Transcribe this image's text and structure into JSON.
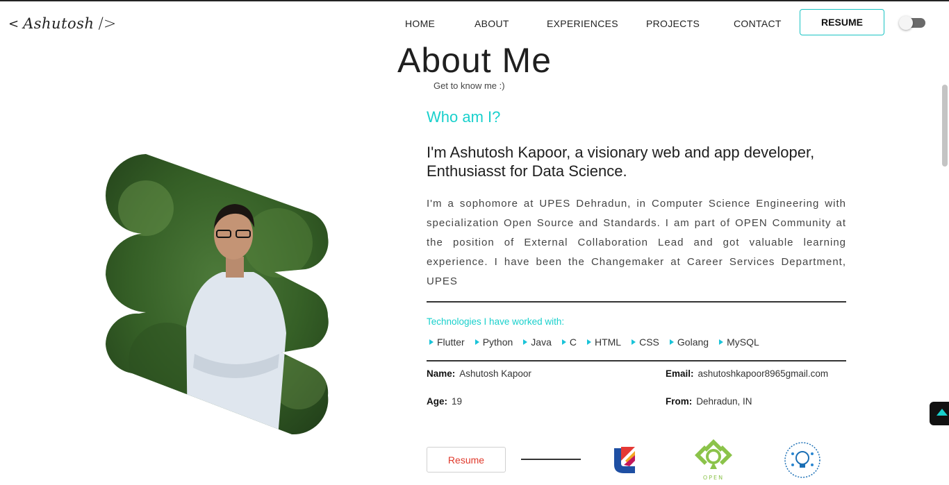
{
  "nav": {
    "logo_left": "<",
    "logo_name": "Ashutosh",
    "logo_right": "/>",
    "links": [
      {
        "label": "HOME"
      },
      {
        "label": "ABOUT"
      },
      {
        "label": "EXPERIENCES"
      },
      {
        "label": "PROJECTS"
      },
      {
        "label": "CONTACT"
      }
    ],
    "resume": "RESUME",
    "theme_toggle": "off"
  },
  "about": {
    "title": "About Me",
    "subtitle": "Get to know me :)",
    "who": "Who am I?",
    "headline": "I'm Ashutosh Kapoor, a visionary web and app developer, Enthusiasst for Data Science.",
    "bio": "I'm a sophomore at UPES Dehradun, in Computer Science Engineering with specialization Open Source and Standards. I am part of OPEN Community at the position of External Collaboration Lead and got valuable learning experience. I have been the Changemaker at Career Services Department, UPES",
    "tech_title": "Technologies I have worked with:",
    "technologies": [
      "Flutter",
      "Python",
      "Java",
      "C",
      "HTML",
      "CSS",
      "Golang",
      "MySQL"
    ],
    "info": {
      "name_label": "Name:",
      "name": "Ashutosh Kapoor",
      "email_label": "Email:",
      "email": "ashutoshkapoor8965gmail.com",
      "age_label": "Age:",
      "age": "19",
      "from_label": "From:",
      "from": "Dehradun, IN"
    },
    "resume_button": "Resume",
    "open_logo_text": "OPEN"
  },
  "colors": {
    "accent": "#19d0cc",
    "resume_text": "#e0392b"
  }
}
